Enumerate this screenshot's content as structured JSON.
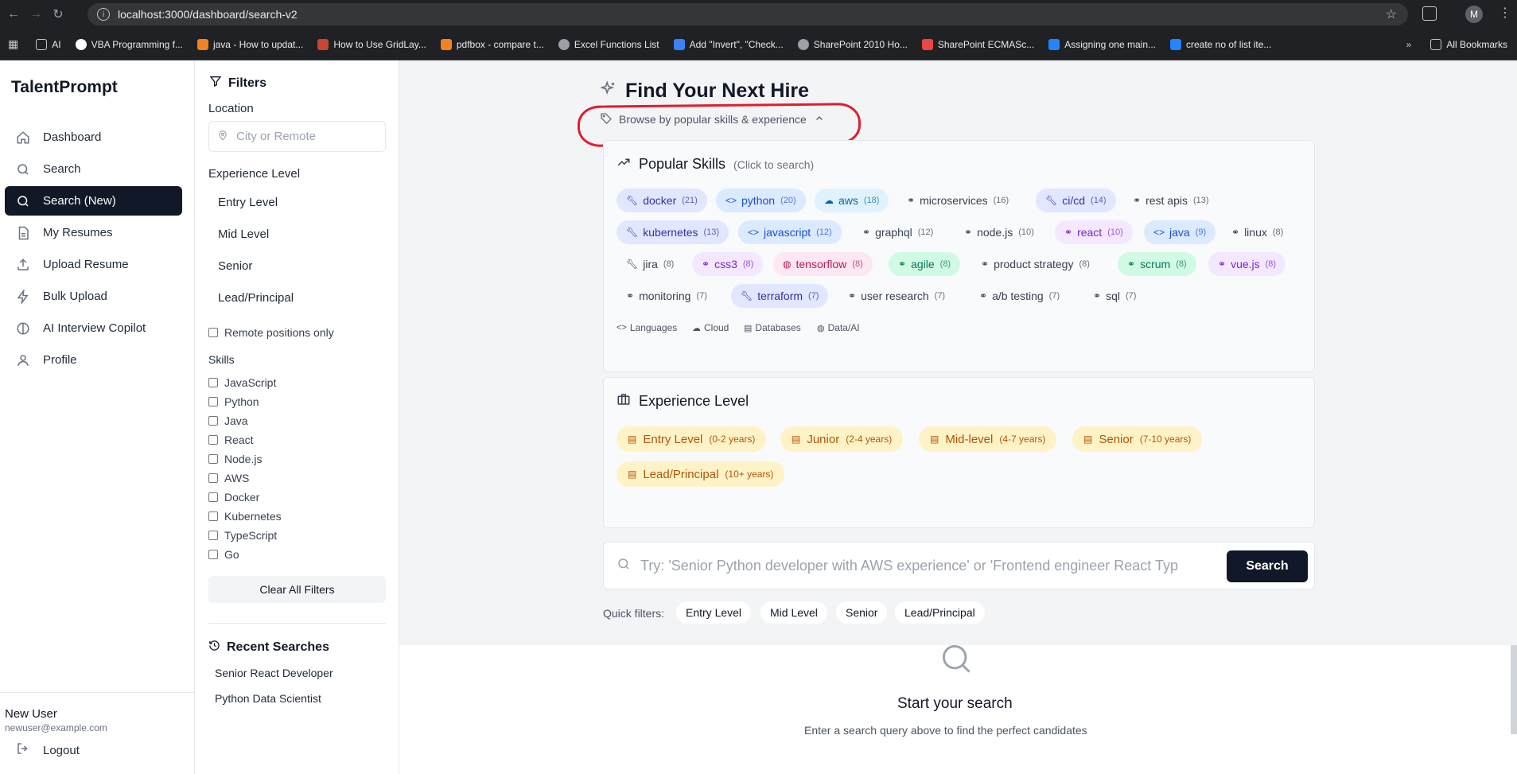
{
  "browser": {
    "url": "localhost:3000/dashboard/search-v2",
    "profile_initial": "M",
    "bookmarks": [
      "AI",
      "VBA Programming f...",
      "java - How to updat...",
      "How to Use GridLay...",
      "pdfbox - compare t...",
      "Excel Functions List",
      "Add \"Invert\", \"Check...",
      "SharePoint 2010 Ho...",
      "SharePoint ECMASc...",
      "Assigning one main...",
      "create no of list ite..."
    ],
    "all_bookmarks": "All Bookmarks"
  },
  "app": {
    "brand": "TalentPrompt"
  },
  "sidebar": {
    "items": [
      {
        "label": "Dashboard",
        "icon": "home-icon"
      },
      {
        "label": "Search",
        "icon": "search-icon"
      },
      {
        "label": "Search (New)",
        "icon": "search-icon",
        "active": true
      },
      {
        "label": "My Resumes",
        "icon": "document-icon"
      },
      {
        "label": "Upload Resume",
        "icon": "upload-icon"
      },
      {
        "label": "Bulk Upload",
        "icon": "lightning-icon"
      },
      {
        "label": "AI Interview Copilot",
        "icon": "brain-icon"
      },
      {
        "label": "Profile",
        "icon": "user-icon"
      }
    ],
    "user_name": "New User",
    "user_email": "newuser@example.com",
    "logout": "Logout"
  },
  "filters": {
    "title": "Filters",
    "location_label": "Location",
    "location_placeholder": "City or Remote",
    "experience_label": "Experience Level",
    "experience_levels": [
      "Entry Level",
      "Mid Level",
      "Senior",
      "Lead/Principal"
    ],
    "remote_label": "Remote positions only",
    "skills_label": "Skills",
    "skills": [
      "JavaScript",
      "Python",
      "Java",
      "React",
      "Node.js",
      "AWS",
      "Docker",
      "Kubernetes",
      "TypeScript",
      "Go"
    ],
    "clear_label": "Clear All Filters",
    "recent_title": "Recent Searches",
    "recent": [
      "Senior React Developer",
      "Python Data Scientist"
    ]
  },
  "main": {
    "title": "Find Your Next Hire",
    "browse_toggle": "Browse by popular skills & experience",
    "popular_title": "Popular Skills",
    "popular_hint": "(Click to search)",
    "skills": [
      {
        "name": "docker",
        "count": "(21)"
      },
      {
        "name": "python",
        "count": "(20)"
      },
      {
        "name": "aws",
        "count": "(18)"
      },
      {
        "name": "microservices",
        "count": "(16)"
      },
      {
        "name": "ci/cd",
        "count": "(14)"
      },
      {
        "name": "rest apis",
        "count": "(13)"
      },
      {
        "name": "kubernetes",
        "count": "(13)"
      },
      {
        "name": "javascript",
        "count": "(12)"
      },
      {
        "name": "graphql",
        "count": "(12)"
      },
      {
        "name": "node.js",
        "count": "(10)"
      },
      {
        "name": "react",
        "count": "(10)"
      },
      {
        "name": "java",
        "count": "(9)"
      },
      {
        "name": "linux",
        "count": "(8)"
      },
      {
        "name": "jira",
        "count": "(8)"
      },
      {
        "name": "css3",
        "count": "(8)"
      },
      {
        "name": "tensorflow",
        "count": "(8)"
      },
      {
        "name": "agile",
        "count": "(8)"
      },
      {
        "name": "product strategy",
        "count": "(8)"
      },
      {
        "name": "scrum",
        "count": "(8)"
      },
      {
        "name": "vue.js",
        "count": "(8)"
      },
      {
        "name": "monitoring",
        "count": "(7)"
      },
      {
        "name": "terraform",
        "count": "(7)"
      },
      {
        "name": "user research",
        "count": "(7)"
      },
      {
        "name": "a/b testing",
        "count": "(7)"
      },
      {
        "name": "sql",
        "count": "(7)"
      }
    ],
    "legend": [
      "Languages",
      "Cloud",
      "Databases",
      "Data/AI"
    ],
    "experience_title": "Experience Level",
    "experience": [
      {
        "name": "Entry Level",
        "range": "(0-2 years)"
      },
      {
        "name": "Junior",
        "range": "(2-4 years)"
      },
      {
        "name": "Mid-level",
        "range": "(4-7 years)"
      },
      {
        "name": "Senior",
        "range": "(7-10 years)"
      },
      {
        "name": "Lead/Principal",
        "range": "(10+ years)"
      }
    ],
    "search_placeholder": "Try: 'Senior Python developer with AWS experience' or 'Frontend engineer React Typ",
    "search_button": "Search",
    "quick_filters_label": "Quick filters:",
    "quick_filters": [
      "Entry Level",
      "Mid Level",
      "Senior",
      "Lead/Principal"
    ],
    "empty_title": "Start your search",
    "empty_sub": "Enter a search query above to find the perfect candidates"
  },
  "colors": {
    "accent": "#111827",
    "annotation": "#e11d2e",
    "experience_chip": "#fef3c7"
  }
}
